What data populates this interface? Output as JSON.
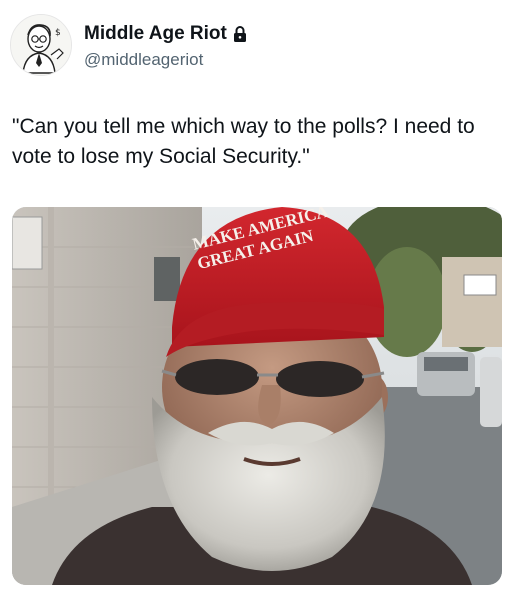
{
  "author": {
    "display_name": "Middle Age Riot",
    "handle": "@middleageriot",
    "protected_icon": "lock-icon",
    "avatar_icon": "cartoon-man-avatar"
  },
  "tweet": {
    "text": "\"Can you tell me which way to the polls? I need to vote to lose my Social Security.\""
  },
  "media": {
    "description_icon": "photo",
    "hat_text_line1": "MAKE AMERICA",
    "hat_text_line2": "GREAT AGAIN"
  }
}
